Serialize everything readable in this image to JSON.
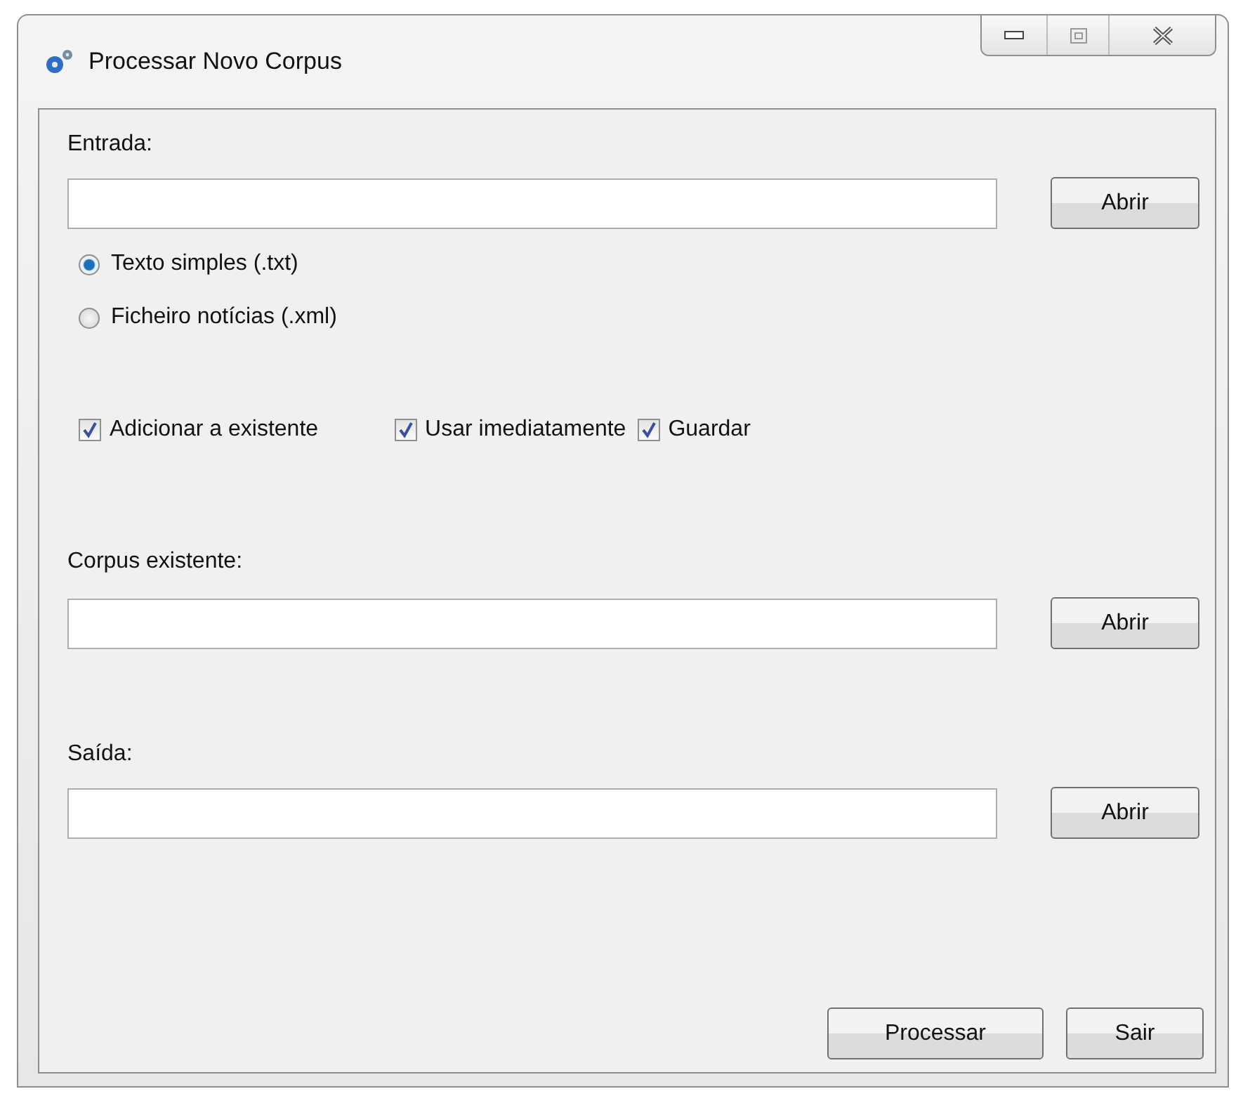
{
  "window": {
    "title": "Processar Novo Corpus"
  },
  "input": {
    "label": "Entrada:",
    "button": "Abrir"
  },
  "formats": [
    {
      "label": "Texto simples (.txt)",
      "selected": true
    },
    {
      "label": "Ficheiro notícias (.xml)",
      "selected": false
    }
  ],
  "options": [
    {
      "label": "Adicionar a existente",
      "checked": true
    },
    {
      "label": "Usar imediatamente",
      "checked": true
    },
    {
      "label": "Guardar",
      "checked": true
    }
  ],
  "existing_corpus": {
    "label": "Corpus existente:",
    "button": "Abrir"
  },
  "output": {
    "label": "Saída:",
    "button": "Abrir"
  },
  "actions": [
    "Processar",
    "Sair"
  ]
}
